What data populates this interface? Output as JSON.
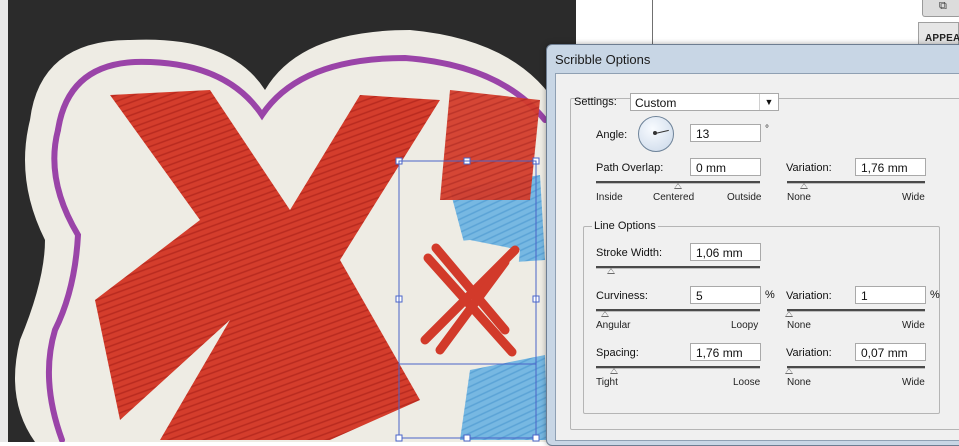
{
  "side_tab": {
    "label": "APPEAR",
    "icon": "panel-icon"
  },
  "dialog": {
    "title": "Scribble Options",
    "settings": {
      "label": "Settings:",
      "value": "Custom"
    },
    "angle": {
      "label": "Angle:",
      "value": "13",
      "unit": "°"
    },
    "path_overlap": {
      "label": "Path Overlap:",
      "value": "0 mm",
      "variation_label": "Variation:",
      "variation_value": "1,76 mm",
      "ticks": [
        "Inside",
        "Centered",
        "Outside"
      ],
      "variation_ticks": [
        "None",
        "Wide"
      ]
    },
    "line_options": {
      "title": "Line Options",
      "stroke_width": {
        "label": "Stroke Width:",
        "value": "1,06 mm"
      },
      "curviness": {
        "label": "Curviness:",
        "value": "5",
        "unit": "%",
        "variation_label": "Variation:",
        "variation_value": "1",
        "variation_unit": "%",
        "ticks": [
          "Angular",
          "Loopy"
        ],
        "variation_ticks": [
          "None",
          "Wide"
        ]
      },
      "spacing": {
        "label": "Spacing:",
        "value": "1,76 mm",
        "variation_label": "Variation:",
        "variation_value": "0,07 mm",
        "ticks": [
          "Tight",
          "Loose"
        ],
        "variation_ticks": [
          "None",
          "Wide"
        ]
      }
    }
  },
  "colors": {
    "scribble_red": "#d23a2a",
    "scribble_blue": "#6fb4e0",
    "outline_purple": "#9a44a8",
    "selection_blue": "#4a64c8"
  }
}
